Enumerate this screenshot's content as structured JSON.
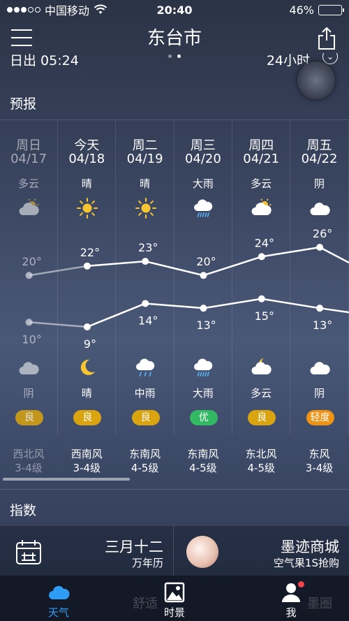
{
  "status_bar": {
    "carrier": "中国移动",
    "time": "20:40",
    "battery": "46%",
    "battery_level": 0.46
  },
  "header": {
    "city": "东台市",
    "page_count": 2,
    "active_page": 1
  },
  "sun_row": {
    "sunrise": "日出 05:24",
    "hours24": "24小时"
  },
  "forecast": {
    "title": "预报",
    "days": [
      {
        "name": "周日",
        "date": "04/17",
        "day_cond": "多云",
        "day_icon": "partly-cloudy-icon",
        "high": "20°",
        "low": "10°",
        "night_icon": "cloudy-icon",
        "night_cond": "阴",
        "aqi": "良",
        "wind_dir": "西北风",
        "wind_level": "3-4级",
        "past": true
      },
      {
        "name": "今天",
        "date": "04/18",
        "day_cond": "晴",
        "day_icon": "sun-icon",
        "high": "22°",
        "low": "9°",
        "night_icon": "moon-icon",
        "night_cond": "晴",
        "aqi": "良",
        "wind_dir": "西南风",
        "wind_level": "3-4级",
        "past": false
      },
      {
        "name": "周二",
        "date": "04/19",
        "day_cond": "晴",
        "day_icon": "sun-icon",
        "high": "23°",
        "low": "14°",
        "night_icon": "rain-icon",
        "night_cond": "中雨",
        "aqi": "良",
        "wind_dir": "东南风",
        "wind_level": "4-5级",
        "past": false
      },
      {
        "name": "周三",
        "date": "04/20",
        "day_cond": "大雨",
        "day_icon": "heavy-rain-icon",
        "high": "20°",
        "low": "13°",
        "night_icon": "heavy-rain-icon",
        "night_cond": "大雨",
        "aqi": "优",
        "wind_dir": "东南风",
        "wind_level": "4-5级",
        "past": false
      },
      {
        "name": "周四",
        "date": "04/21",
        "day_cond": "多云",
        "day_icon": "partly-cloudy-icon",
        "high": "24°",
        "low": "15°",
        "night_icon": "partly-cloudy-night-icon",
        "night_cond": "多云",
        "aqi": "良",
        "wind_dir": "东北风",
        "wind_level": "4-5级",
        "past": false
      },
      {
        "name": "周五",
        "date": "04/22",
        "day_cond": "阴",
        "day_icon": "cloudy-icon",
        "high": "26°",
        "low": "13°",
        "night_icon": "cloudy-icon",
        "night_cond": "阴",
        "aqi": "轻度",
        "wind_dir": "东风",
        "wind_level": "3-4级",
        "past": false
      }
    ]
  },
  "chart_data": {
    "type": "line",
    "categories": [
      "04/17",
      "04/18",
      "04/19",
      "04/20",
      "04/21",
      "04/22"
    ],
    "series": [
      {
        "values": [
          20,
          22,
          23,
          20,
          24,
          26
        ]
      },
      {
        "values": [
          10,
          9,
          14,
          13,
          15,
          13
        ]
      }
    ]
  },
  "colors": {
    "aqi_good": "#d9a40f",
    "aqi_excellent": "#33b864",
    "aqi_light": "#ef9314",
    "accent": "#2f9cf5"
  },
  "index": {
    "title": "指数",
    "cards": [
      {
        "title": "三月十二",
        "sub": "万年历",
        "icon": "calendar-icon"
      },
      {
        "title": "墨迹商城",
        "sub": "空气果1S抢购",
        "icon": "air-fruit-icon"
      }
    ]
  },
  "tab_bar": {
    "tabs": [
      {
        "label": "天气",
        "icon": "cloud-icon",
        "active": true
      },
      {
        "label": "时景",
        "icon": "photo-icon",
        "active": false
      },
      {
        "label": "我",
        "icon": "person-icon",
        "active": false,
        "badge": true
      }
    ],
    "ghost_text": [
      "舒适",
      "墨圈"
    ]
  }
}
